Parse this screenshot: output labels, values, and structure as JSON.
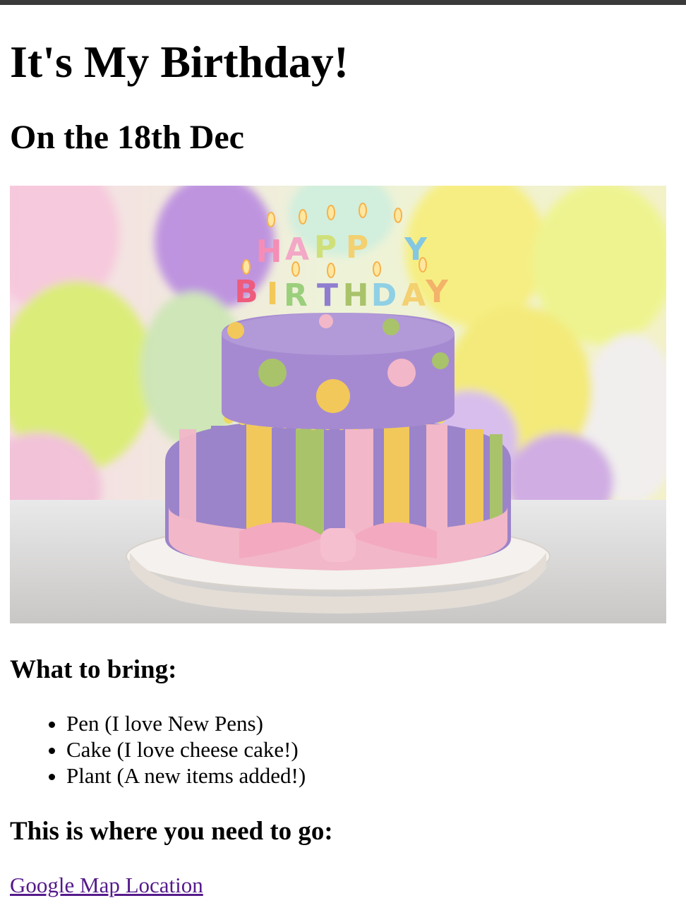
{
  "page": {
    "heading": "It's My Birthday!",
    "subheading": "On the 18th Dec"
  },
  "image": {
    "candle_letters": [
      "H",
      "A",
      "P",
      "P",
      "Y",
      "B",
      "I",
      "R",
      "T",
      "H",
      "D",
      "A",
      "Y"
    ],
    "colors": {
      "cake_purple": "#9b84c9",
      "cake_yellow": "#f2c85a",
      "cake_green": "#a9c36a",
      "cake_pink": "#f2b7c8",
      "plate": "#f4f1ee"
    }
  },
  "bring": {
    "heading": "What to bring:",
    "items": [
      "Pen (I love New Pens)",
      "Cake (I love cheese cake!)",
      "Plant (A new items added!)"
    ]
  },
  "location": {
    "heading": "This is where you need to go:",
    "link_text": "Google Map Location",
    "link_color": "#551a8b"
  }
}
